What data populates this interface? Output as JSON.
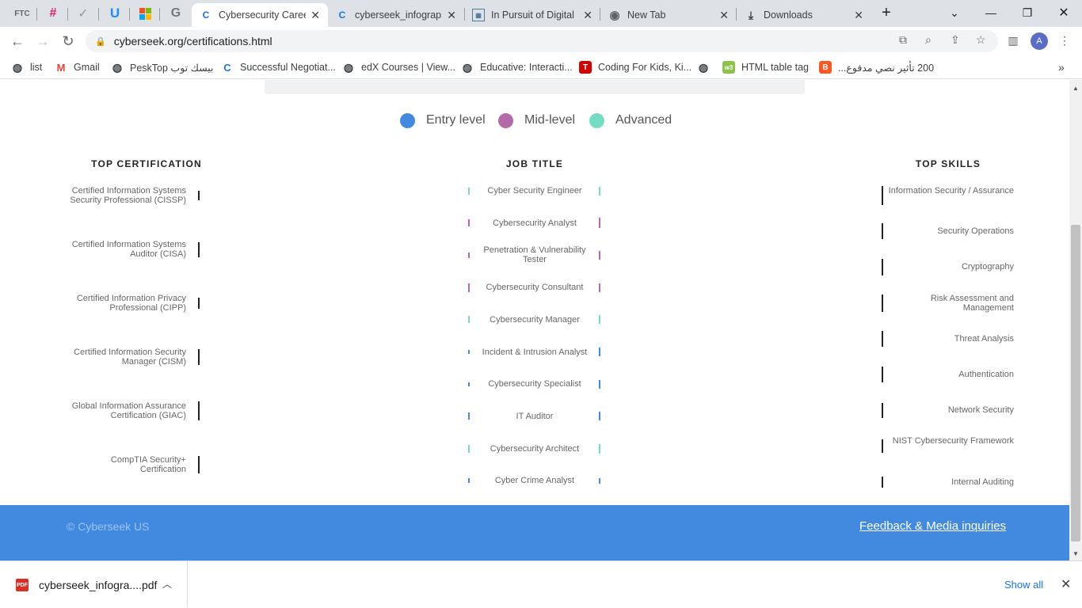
{
  "browser": {
    "pinned_tabs": [
      {
        "name": "FTC",
        "icon": "ftc-icon"
      },
      {
        "name": "Slack",
        "icon": "slack-icon"
      },
      {
        "name": "Tasks",
        "icon": "checkmark-icon"
      },
      {
        "name": "Webflow",
        "icon": "u-logo-icon"
      },
      {
        "name": "Microsoft",
        "icon": "microsoft-icon"
      },
      {
        "name": "Google",
        "icon": "google-icon"
      }
    ],
    "tabs": [
      {
        "title": "Cybersecurity Caree",
        "icon": "c-logo-icon",
        "active": true
      },
      {
        "title": "cyberseek_infograph",
        "icon": "c-logo-icon",
        "active": false
      },
      {
        "title": "In Pursuit of Digital",
        "icon": "image-icon",
        "active": false
      },
      {
        "title": "New Tab",
        "icon": "chrome-icon",
        "active": false
      },
      {
        "title": "Downloads",
        "icon": "download-icon",
        "active": false
      }
    ],
    "url": "cyberseek.org/certifications.html",
    "avatar_initial": "A",
    "bookmarks": [
      {
        "label": "list",
        "icon": "globe-icon",
        "color": "#3c4043"
      },
      {
        "label": "Gmail",
        "icon": "gmail-icon",
        "color": "#ea4335"
      },
      {
        "label": "PeskTop بيسك توب",
        "icon": "globe-icon",
        "color": "#3c4043"
      },
      {
        "label": "Successful Negotiat...",
        "icon": "c-logo-icon",
        "color": "#1a73e8"
      },
      {
        "label": "edX Courses | View...",
        "icon": "globe-icon",
        "color": "#3c4043"
      },
      {
        "label": "Educative: Interacti...",
        "icon": "globe-icon",
        "color": "#3c4043"
      },
      {
        "label": "Coding For Kids, Ki...",
        "icon": "tynker-icon",
        "color": "#d50000"
      },
      {
        "label": "",
        "icon": "globe-icon",
        "color": "#3c4043"
      },
      {
        "label": "HTML table tag",
        "icon": "w3-icon",
        "color": "#8bc34a"
      },
      {
        "label": "200 تأثير نصي مدفوع...",
        "icon": "blogger-icon",
        "color": "#ff5722"
      }
    ]
  },
  "page": {
    "legend": [
      {
        "label": "Entry level",
        "color": "#4289e0"
      },
      {
        "label": "Mid-level",
        "color": "#b469a8"
      },
      {
        "label": "Advanced",
        "color": "#75dcc4"
      }
    ],
    "headers": {
      "certification": "TOP CERTIFICATION",
      "job": "JOB TITLE",
      "skills": "TOP SKILLS"
    },
    "certifications": [
      {
        "label": "Certified Information Systems Security Professional (CISSP)",
        "weight": 0.35
      },
      {
        "label": "Certified Information Systems Auditor (CISA)",
        "weight": 0.7
      },
      {
        "label": "Certified Information Privacy Professional (CIPP)",
        "weight": 0.45
      },
      {
        "label": "Certified Information Security Manager (CISM)",
        "weight": 0.75
      },
      {
        "label": "Global Information Assurance Certification (GIAC)",
        "weight": 1.0
      },
      {
        "label": "CompTIA Security+ Certification",
        "weight": 0.9
      }
    ],
    "jobs": [
      {
        "label": "Cyber Security Engineer",
        "level": "advanced",
        "left": 0.45,
        "right": 0.6
      },
      {
        "label": "Cybersecurity Analyst",
        "level": "mid",
        "left": 0.45,
        "right": 0.7
      },
      {
        "label": "Penetration & Vulnerability Tester",
        "level": "mid",
        "left": 0.3,
        "right": 0.6
      },
      {
        "label": "Cybersecurity Consultant",
        "level": "mid",
        "left": 0.55,
        "right": 0.6
      },
      {
        "label": "Cybersecurity Manager",
        "level": "advanced",
        "left": 0.45,
        "right": 0.55
      },
      {
        "label": "Incident & Intrusion Analyst",
        "level": "entry",
        "left": 0.15,
        "right": 0.55
      },
      {
        "label": "Cybersecurity Specialist",
        "level": "entry",
        "left": 0.15,
        "right": 0.6
      },
      {
        "label": "IT Auditor",
        "level": "entry",
        "left": 0.45,
        "right": 0.6
      },
      {
        "label": "Cybersecurity Architect",
        "level": "advanced",
        "left": 0.5,
        "right": 0.65
      },
      {
        "label": "Cyber Crime Analyst",
        "level": "entry",
        "left": 0.2,
        "right": 0.25
      }
    ],
    "skills": [
      {
        "label": "Information Security / Assurance",
        "weight": 1.0
      },
      {
        "label": "Security Operations",
        "weight": 0.8
      },
      {
        "label": "Cryptography",
        "weight": 0.85
      },
      {
        "label": "Risk Assessment and Management",
        "weight": 0.9
      },
      {
        "label": "Threat Analysis",
        "weight": 0.8
      },
      {
        "label": "Authentication",
        "weight": 0.75
      },
      {
        "label": "Network Security",
        "weight": 0.7
      },
      {
        "label": "NIST Cybersecurity Framework",
        "weight": 0.6
      },
      {
        "label": "Internal Auditing",
        "weight": 0.45
      }
    ],
    "footer": {
      "copyright": "© Cyberseek US",
      "feedback": "Feedback & Media inquiries",
      "color": "#4289e0"
    }
  },
  "downloads": {
    "filename": "cyberseek_infogra....pdf",
    "file_type": "PDF",
    "show_all": "Show all"
  }
}
